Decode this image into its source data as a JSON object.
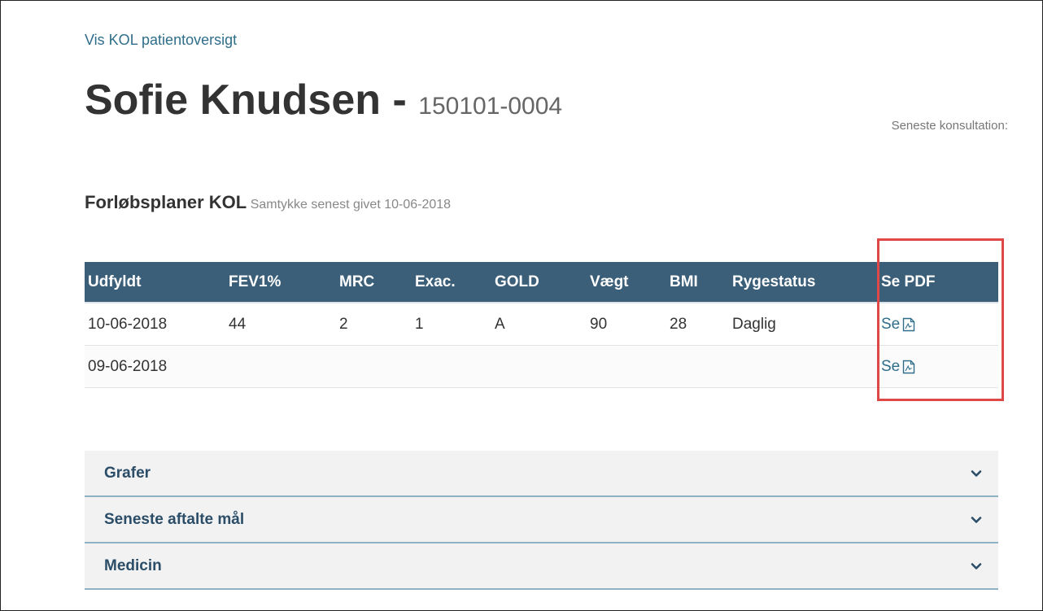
{
  "nav": {
    "back_link": "Vis KOL patientoversigt"
  },
  "patient": {
    "name": "Sofie Knudsen",
    "separator": "-",
    "cpr": "150101-0004"
  },
  "latest_consultation_label": "Seneste konsultation:",
  "plans": {
    "title": "Forløbsplaner KOL",
    "consent": "Samtykke senest givet 10-06-2018"
  },
  "table": {
    "headers": [
      "Udfyldt",
      "FEV1%",
      "MRC",
      "Exac.",
      "GOLD",
      "Vægt",
      "BMI",
      "Rygestatus",
      "Se PDF"
    ],
    "rows": [
      {
        "cells": [
          "10-06-2018",
          "44",
          "2",
          "1",
          "A",
          "90",
          "28",
          "Daglig"
        ],
        "pdf_label": "Se"
      },
      {
        "cells": [
          "09-06-2018",
          "",
          "",
          "",
          "",
          "",
          "",
          ""
        ],
        "pdf_label": "Se"
      }
    ]
  },
  "icons": {
    "pdf": "pdf-file-icon",
    "chevron": "chevron-down-icon"
  },
  "accordion": [
    {
      "label": "Grafer"
    },
    {
      "label": "Seneste aftalte mål"
    },
    {
      "label": "Medicin"
    }
  ],
  "colors": {
    "header_bg": "#3b5f79",
    "link": "#2f6e8a",
    "highlight": "#e04848",
    "accordion_text": "#2b4d68"
  }
}
